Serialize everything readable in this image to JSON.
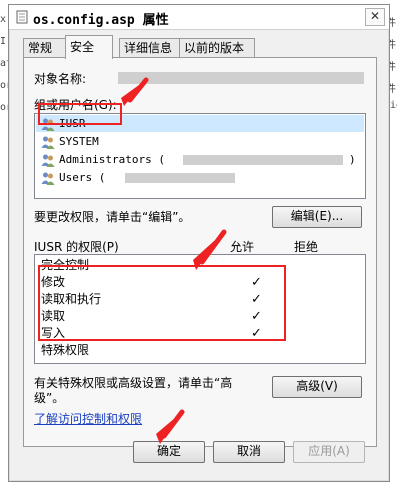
{
  "background": {
    "left_fragments": [
      "x.",
      "I",
      "att",
      "or",
      "or"
    ],
    "right_fragments": [
      "件",
      "件",
      "件",
      "fig",
      "件"
    ]
  },
  "window": {
    "title": "os.config.asp 属性",
    "close_symbol": "✕"
  },
  "tabs": [
    {
      "label": "常规",
      "active": false
    },
    {
      "label": "安全",
      "active": true
    },
    {
      "label": "详细信息",
      "active": false
    },
    {
      "label": "以前的版本",
      "active": false
    }
  ],
  "object": {
    "label": "对象名称:"
  },
  "groups": {
    "label": "组或用户名(G):",
    "users": [
      {
        "name": "IUSR",
        "icon": "users-icon",
        "selected": true
      },
      {
        "name": "SYSTEM",
        "icon": "users-icon",
        "selected": false
      },
      {
        "name": "Administrators (",
        "suffix": ")",
        "icon": "users-icon",
        "selected": false
      },
      {
        "name": "Users (",
        "suffix": "",
        "icon": "users-icon",
        "selected": false
      }
    ]
  },
  "edit": {
    "hint": "要更改权限，请单击“编辑”。",
    "button": "编辑(E)..."
  },
  "permissions": {
    "header": "IUSR 的权限(P)",
    "allow": "允许",
    "deny": "拒绝",
    "rows": [
      {
        "name": "完全控制",
        "allow": false
      },
      {
        "name": "修改",
        "allow": true
      },
      {
        "name": "读取和执行",
        "allow": true
      },
      {
        "name": "读取",
        "allow": true
      },
      {
        "name": "写入",
        "allow": true
      },
      {
        "name": "特殊权限",
        "allow": false
      }
    ],
    "check_symbol": "✓"
  },
  "advanced": {
    "hint_line1": "有关特殊权限或高级设置，请单击“高",
    "hint_line2": "级”。",
    "button": "高级(V)"
  },
  "link": "了解访问控制和权限",
  "footer": {
    "ok": "确定",
    "cancel": "取消",
    "apply": "应用(A)"
  },
  "colors": {
    "annotation": "#e22222",
    "link": "#1a3fc0",
    "selection": "#cde8ff"
  }
}
